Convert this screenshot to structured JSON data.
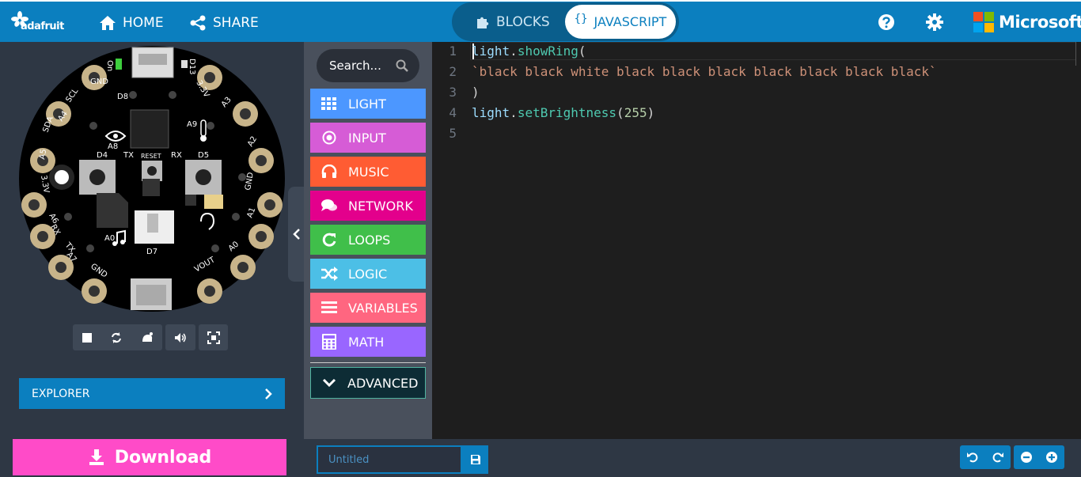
{
  "app": {
    "logo_text": "adafruit",
    "brand": "Microsoft",
    "accent_color": "#0b7fbf",
    "download_color": "#ff4bc8"
  },
  "header": {
    "home_label": "HOME",
    "share_label": "SHARE",
    "blocks_label": "BLOCKS",
    "javascript_label": "JAVASCRIPT",
    "javascript_icon": "{}",
    "active_tab": "JAVASCRIPT",
    "icons": [
      "home-icon",
      "share-icon",
      "puzzle-icon",
      "help-icon",
      "gear-icon"
    ]
  },
  "simulator": {
    "controls": [
      "stop-icon",
      "restart-icon",
      "slow-motion-icon",
      "sound-icon",
      "fullscreen-icon"
    ],
    "explorer_label": "EXPLORER",
    "download_label": "Download",
    "board_labels": [
      "GND",
      "D8",
      "A9",
      "A8",
      "D4",
      "TX",
      "RESET",
      "RX",
      "D5",
      "A0",
      "D7",
      "SCL",
      "A4",
      "SDA",
      "A5",
      "3.3V",
      "A6",
      "RX",
      "A7",
      "TX",
      "GND",
      "VOUT",
      "GND",
      "A1",
      "A2",
      "A3",
      "3.3V",
      "D13",
      "On",
      "A0"
    ],
    "leds": [
      "black",
      "black",
      "white",
      "black",
      "black",
      "black",
      "black",
      "black",
      "black",
      "black"
    ]
  },
  "toolbox": {
    "search_placeholder": "Search...",
    "categories": [
      {
        "label": "LIGHT",
        "color": "#4c97ff",
        "icon": "grid-icon"
      },
      {
        "label": "INPUT",
        "color": "#d65cd6",
        "icon": "input-icon"
      },
      {
        "label": "MUSIC",
        "color": "#ff5c33",
        "icon": "headphones-icon"
      },
      {
        "label": "NETWORK",
        "color": "#e3008c",
        "icon": "chat-icon"
      },
      {
        "label": "LOOPS",
        "color": "#40bf4a",
        "icon": "loop-icon"
      },
      {
        "label": "LOGIC",
        "color": "#4cbfe6",
        "icon": "shuffle-icon"
      },
      {
        "label": "VARIABLES",
        "color": "#ff6680",
        "icon": "list-icon"
      },
      {
        "label": "MATH",
        "color": "#9966ff",
        "icon": "calculator-icon"
      }
    ],
    "advanced_label": "ADVANCED"
  },
  "editor": {
    "line_numbers": [
      "1",
      "2",
      "3",
      "4",
      "5"
    ],
    "lines": [
      {
        "obj": "light",
        "dot": ".",
        "fn": "showRing",
        "rest": "("
      },
      {
        "str": "`black black white black black black black black black black`"
      },
      {
        "punc": ")"
      },
      {
        "obj": "light",
        "dot": ".",
        "fn": "setBrightness",
        "open": "(",
        "num": "255",
        "close": ")"
      }
    ]
  },
  "footer": {
    "project_name_placeholder": "Untitled",
    "save_icon": "save-icon",
    "undo_icon": "undo-icon",
    "redo_icon": "redo-icon",
    "zoom_out_icon": "zoom-out-icon",
    "zoom_in_icon": "zoom-in-icon"
  }
}
